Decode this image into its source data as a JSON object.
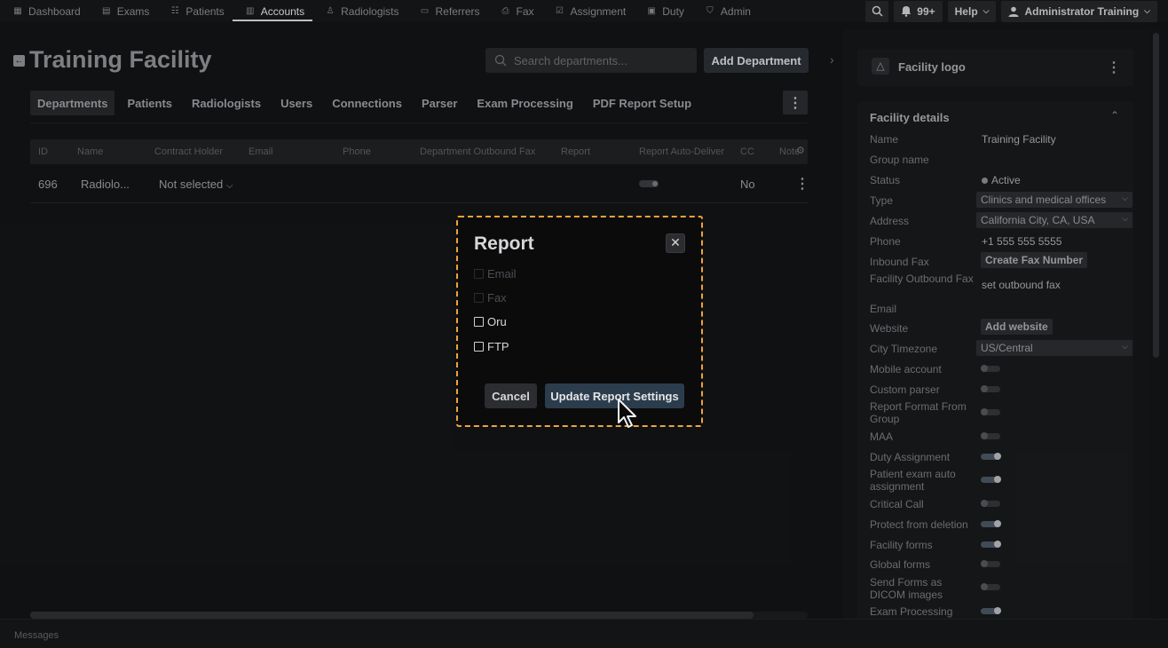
{
  "nav": {
    "items": [
      {
        "label": "Dashboard",
        "icon": "dashboard-icon",
        "glyph": "▦"
      },
      {
        "label": "Exams",
        "icon": "exams-icon",
        "glyph": "▤"
      },
      {
        "label": "Patients",
        "icon": "patients-icon",
        "glyph": "👥"
      },
      {
        "label": "Accounts",
        "icon": "accounts-icon",
        "glyph": "▥"
      },
      {
        "label": "Radiologists",
        "icon": "radiologists-icon",
        "glyph": "♙"
      },
      {
        "label": "Referrers",
        "icon": "referrers-icon",
        "glyph": "▭"
      },
      {
        "label": "Fax",
        "icon": "fax-icon",
        "glyph": "⎙"
      },
      {
        "label": "Assignment",
        "icon": "assignment-icon",
        "glyph": "☑"
      },
      {
        "label": "Duty",
        "icon": "duty-icon",
        "glyph": "▣"
      },
      {
        "label": "Admin",
        "icon": "admin-icon",
        "glyph": "⛉"
      }
    ],
    "active": "Accounts",
    "notifications": "99+",
    "help": "Help",
    "user": "Administrator Training"
  },
  "page": {
    "title": "Training Facility",
    "search_placeholder": "Search departments...",
    "add_department": "Add Department"
  },
  "tabs": [
    {
      "label": "Departments",
      "active": true
    },
    {
      "label": "Patients"
    },
    {
      "label": "Radiologists"
    },
    {
      "label": "Users"
    },
    {
      "label": "Connections"
    },
    {
      "label": "Parser"
    },
    {
      "label": "Exam Processing"
    },
    {
      "label": "PDF Report Setup"
    }
  ],
  "table": {
    "headers": [
      "ID",
      "Name",
      "Contract Holder",
      "Email",
      "Phone",
      "Department Outbound Fax",
      "Report",
      "Report Auto-Deliver",
      "CC",
      "Note"
    ],
    "rows": [
      {
        "id": "696",
        "name": "Radiolo...",
        "contract_holder": "Not selected",
        "cc": "No"
      }
    ]
  },
  "footer": {
    "label": "Messages"
  },
  "panel": {
    "logo_label": "Facility logo",
    "details_title": "Facility details",
    "fields": {
      "name_label": "Name",
      "name_value": "Training Facility",
      "group_label": "Group name",
      "status_label": "Status",
      "status_value": "Active",
      "type_label": "Type",
      "type_value": "Clinics and medical offices",
      "address_label": "Address",
      "address_value": "California City, CA, USA",
      "phone_label": "Phone",
      "phone_value": "+1 555 555 5555",
      "inbound_fax_label": "Inbound Fax",
      "inbound_fax_button": "Create Fax Number",
      "outbound_fax_label": "Facility Outbound Fax",
      "outbound_fax_value": "set outbound fax",
      "email_label": "Email",
      "website_label": "Website",
      "website_button": "Add website",
      "timezone_label": "City Timezone",
      "timezone_value": "US/Central"
    },
    "toggles": [
      {
        "label": "Mobile account",
        "on": false
      },
      {
        "label": "Custom parser",
        "on": false
      },
      {
        "label": "Report Format From Group",
        "on": false
      },
      {
        "label": "MAA",
        "on": false
      },
      {
        "label": "Duty Assignment",
        "on": true
      },
      {
        "label": "Patient exam auto assignment",
        "on": true
      },
      {
        "label": "Critical Call",
        "on": false
      },
      {
        "label": "Protect from deletion",
        "on": true
      },
      {
        "label": "Facility forms",
        "on": true
      },
      {
        "label": "Global forms",
        "on": false
      },
      {
        "label": "Send Forms as DICOM images",
        "on": false
      },
      {
        "label": "Exam Processing",
        "on": true
      }
    ]
  },
  "modal": {
    "title": "Report",
    "close_glyph": "✕",
    "options": [
      {
        "label": "Email",
        "disabled": true
      },
      {
        "label": "Fax",
        "disabled": true
      },
      {
        "label": "Oru",
        "disabled": false
      },
      {
        "label": "FTP",
        "disabled": false
      }
    ],
    "cancel": "Cancel",
    "update": "Update Report Settings"
  },
  "colors": {
    "accent_frame": "#f0a23c",
    "primary_button": "#2b3c4c"
  }
}
